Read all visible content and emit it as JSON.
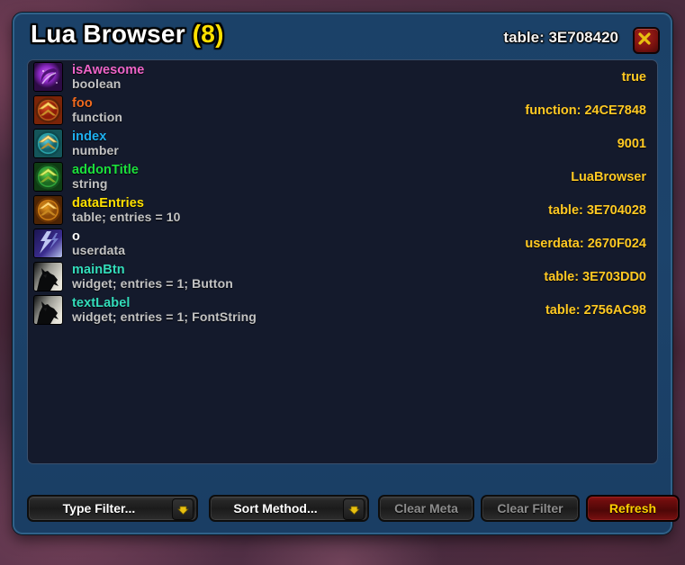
{
  "window": {
    "title_main": "Lua Browser ",
    "title_count": "(8)",
    "header_table_id": "table: 3E708420",
    "close_icon": "close-x-icon",
    "accent_value_color": "#ffc923",
    "frame_color": "#1c436b",
    "panel_color": "#141a2c"
  },
  "entries": [
    {
      "key": "isAwesome",
      "key_color": "#ee64c8",
      "type": "boolean",
      "value": "true",
      "icon": "purple-swirl-icon"
    },
    {
      "key": "foo",
      "key_color": "#f06a1e",
      "type": "function",
      "value": "function: 24CE7848",
      "icon": "red-chevron-medallion-icon"
    },
    {
      "key": "index",
      "key_color": "#1eb0f0",
      "type": "number",
      "value": "9001",
      "icon": "cyan-chevron-medallion-icon"
    },
    {
      "key": "addonTitle",
      "key_color": "#1ce03c",
      "type": "string",
      "value": "LuaBrowser",
      "icon": "green-chevron-medallion-icon"
    },
    {
      "key": "dataEntries",
      "key_color": "#ffe000",
      "type": "table; entries = 10",
      "value": "table: 3E704028",
      "icon": "orange-chevron-medallion-icon"
    },
    {
      "key": "o",
      "key_color": "#ffffff",
      "type": "userdata",
      "value": "userdata: 2670F024",
      "icon": "lightning-bolt-icon"
    },
    {
      "key": "mainBtn",
      "key_color": "#33ddbb",
      "type": "widget; entries = 1; Button",
      "value": "table: 3E703DD0",
      "icon": "wolf-silhouette-icon"
    },
    {
      "key": "textLabel",
      "key_color": "#33ddbb",
      "type": "widget; entries = 1; FontString",
      "value": "table: 2756AC98",
      "icon": "wolf-silhouette-icon"
    }
  ],
  "buttons": {
    "type_filter": "Type Filter...",
    "sort_method": "Sort Method...",
    "clear_meta": "Clear Meta",
    "clear_filter": "Clear Filter",
    "refresh": "Refresh",
    "dropdown_arrow_icon": "chevron-down-icon"
  }
}
